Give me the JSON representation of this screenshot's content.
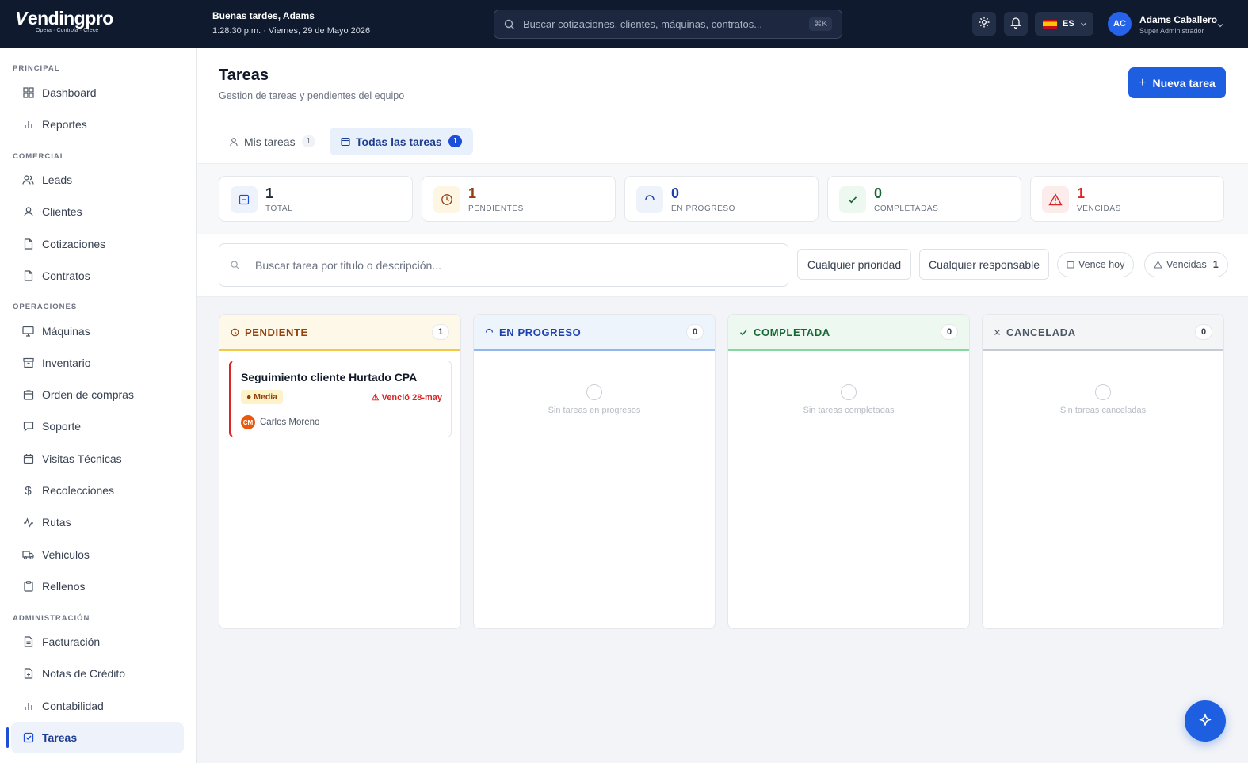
{
  "brand": {
    "logo_mark": "V",
    "logo_text": "endingpro",
    "tagline": "Opera · Controla · Crece"
  },
  "greeting": {
    "title": "Buenas tardes, Adams",
    "datetime": "1:28:30 p.m. · Viernes, 29 de Mayo 2026"
  },
  "global_search": {
    "placeholder": "Buscar cotizaciones, clientes, máquinas, contratos...",
    "shortcut": "⌘K"
  },
  "language": {
    "code": "ES"
  },
  "user": {
    "initials": "AC",
    "name": "Adams Caballero",
    "role": "Super Administrador"
  },
  "sidebar": {
    "sections": [
      {
        "title": "PRINCIPAL",
        "items": [
          {
            "label": "Dashboard",
            "icon": "grid-icon"
          },
          {
            "label": "Reportes",
            "icon": "bar-chart-icon"
          }
        ]
      },
      {
        "title": "COMERCIAL",
        "items": [
          {
            "label": "Leads",
            "icon": "users-icon"
          },
          {
            "label": "Clientes",
            "icon": "user-icon"
          },
          {
            "label": "Cotizaciones",
            "icon": "file-icon"
          },
          {
            "label": "Contratos",
            "icon": "file-icon"
          }
        ]
      },
      {
        "title": "OPERACIONES",
        "items": [
          {
            "label": "Máquinas",
            "icon": "monitor-icon"
          },
          {
            "label": "Inventario",
            "icon": "archive-icon"
          },
          {
            "label": "Orden de compras",
            "icon": "shopping-bag-icon"
          },
          {
            "label": "Soporte",
            "icon": "message-icon"
          },
          {
            "label": "Visitas Técnicas",
            "icon": "calendar-icon"
          },
          {
            "label": "Recolecciones",
            "icon": "dollar-icon"
          },
          {
            "label": "Rutas",
            "icon": "activity-icon"
          },
          {
            "label": "Vehiculos",
            "icon": "truck-icon"
          },
          {
            "label": "Rellenos",
            "icon": "clipboard-icon"
          }
        ]
      },
      {
        "title": "ADMINISTRACIÓN",
        "items": [
          {
            "label": "Facturación",
            "icon": "receipt-icon"
          },
          {
            "label": "Notas de Crédito",
            "icon": "file-plus-icon"
          },
          {
            "label": "Contabilidad",
            "icon": "bar-chart-icon"
          },
          {
            "label": "Tareas",
            "icon": "check-square-icon",
            "active": true
          }
        ]
      }
    ]
  },
  "page": {
    "title": "Tareas",
    "subtitle": "Gestion de tareas y pendientes del equipo",
    "new_button": "Nueva tarea"
  },
  "tabs": [
    {
      "label": "Mis tareas",
      "count": "1",
      "active": false
    },
    {
      "label": "Todas las tareas",
      "count": "1",
      "active": true
    }
  ],
  "stats": [
    {
      "value": "1",
      "label": "TOTAL",
      "color": "#1f2937",
      "icon": "square-icon"
    },
    {
      "value": "1",
      "label": "PENDIENTES",
      "color": "#92400e",
      "icon": "clock-icon"
    },
    {
      "value": "0",
      "label": "EN PROGRESO",
      "color": "#1e40af",
      "icon": "loader-icon"
    },
    {
      "value": "0",
      "label": "COMPLETADAS",
      "color": "#166534",
      "icon": "check-icon"
    },
    {
      "value": "1",
      "label": "VENCIDAS",
      "color": "#dc2626",
      "icon": "alert-triangle-icon"
    }
  ],
  "filters": {
    "search_placeholder": "Buscar tarea por titulo o descripción...",
    "priority": "Cualquier prioridad",
    "assignee": "Cualquier responsable",
    "due_today": "Vence hoy",
    "overdue": {
      "label": "Vencidas",
      "count": "1"
    }
  },
  "columns": [
    {
      "title": "PENDIENTE",
      "count": "1",
      "color": "#92400e",
      "bg": "#fdf8e7",
      "border": "#f2c84b",
      "empty_text": ""
    },
    {
      "title": "EN PROGRESO",
      "count": "0",
      "color": "#1e40af",
      "bg": "#eef4fc",
      "border": "#93b7ea",
      "empty_text": "Sin tareas en progresos"
    },
    {
      "title": "COMPLETADA",
      "count": "0",
      "color": "#166534",
      "bg": "#edf9f0",
      "border": "#86d8a0",
      "empty_text": "Sin tareas completadas"
    },
    {
      "title": "CANCELADA",
      "count": "0",
      "color": "#4b5563",
      "bg": "#f4f5f7",
      "border": "#c5cad3",
      "empty_text": "Sin tareas canceladas"
    }
  ],
  "task_card": {
    "title": "Seguimiento cliente Hurtado CPA",
    "priority": "● Media",
    "due": "⚠ Venció 28-may",
    "assignee_initials": "CM",
    "assignee": "Carlos Moreno"
  }
}
